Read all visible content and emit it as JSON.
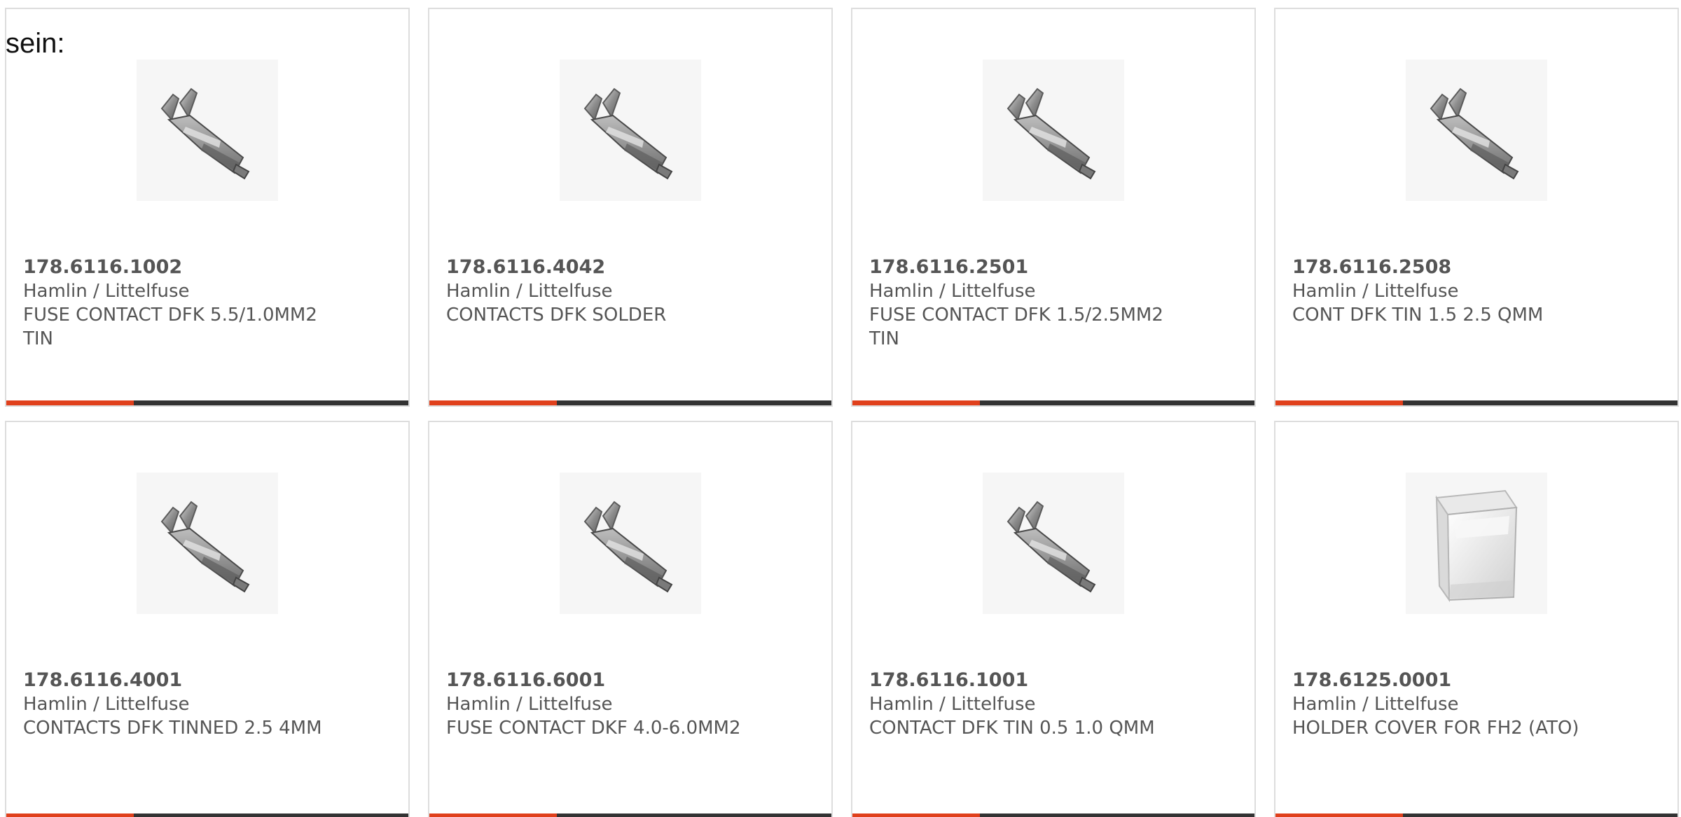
{
  "intro": "sein:",
  "products": [
    {
      "part": "178.6116.1002",
      "maker": "Hamlin / Littelfuse",
      "desc": "FUSE CONTACT DFK 5.5/1.0MM2 TIN",
      "image": "metal-contact-icon"
    },
    {
      "part": "178.6116.4042",
      "maker": "Hamlin / Littelfuse",
      "desc": "CONTACTS DFK SOLDER",
      "image": "metal-contact-icon"
    },
    {
      "part": "178.6116.2501",
      "maker": "Hamlin / Littelfuse",
      "desc": "FUSE CONTACT DFK 1.5/2.5MM2 TIN",
      "image": "metal-contact-icon"
    },
    {
      "part": "178.6116.2508",
      "maker": "Hamlin / Littelfuse",
      "desc": "CONT DFK TIN 1.5 2.5 QMM",
      "image": "metal-contact-icon"
    },
    {
      "part": "178.6116.4001",
      "maker": "Hamlin / Littelfuse",
      "desc": "CONTACTS DFK TINNED 2.5 4MM",
      "image": "metal-contact-icon"
    },
    {
      "part": "178.6116.6001",
      "maker": "Hamlin / Littelfuse",
      "desc": "FUSE CONTACT DKF 4.0-6.0MM2",
      "image": "metal-contact-icon"
    },
    {
      "part": "178.6116.1001",
      "maker": "Hamlin / Littelfuse",
      "desc": "CONTACT DFK TIN 0.5 1.0 QMM",
      "image": "metal-contact-icon"
    },
    {
      "part": "178.6125.0001",
      "maker": "Hamlin / Littelfuse",
      "desc": "HOLDER COVER FOR FH2 (ATO)",
      "image": "clear-cover-icon"
    }
  ],
  "colors": {
    "accent": "#e0401c",
    "bar": "#333333",
    "border": "#dddddd",
    "text": "#555555"
  }
}
